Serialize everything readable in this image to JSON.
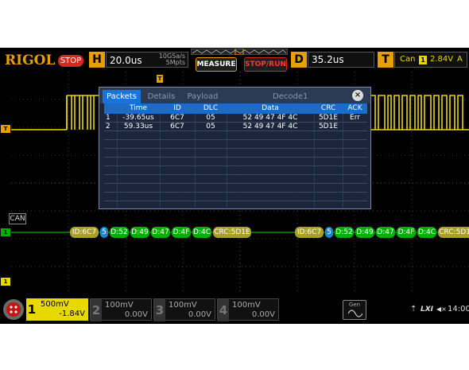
{
  "brand": {
    "logo": "RIGOL",
    "run_state": "STOP"
  },
  "horizontal": {
    "key": "H",
    "timebase": "20.0us",
    "sample_rate": "10GSa/s",
    "memory_depth": "5Mpts"
  },
  "buttons": {
    "measure": "MEASURE",
    "stop_run": "STOP/RUN"
  },
  "delay": {
    "key": "D",
    "value": "35.2us"
  },
  "trigger": {
    "key": "T",
    "source": "Can",
    "channel": "1",
    "level": "2.84V",
    "mode": "A"
  },
  "markers": {
    "trigger_level": "T",
    "channel1": "1",
    "decode_ref": "1",
    "channel2": "2",
    "trigger_pos": "T"
  },
  "decode_label": "CAN",
  "decode_frames": [
    [
      "ID:6C7",
      "5",
      "D:52",
      "D:49",
      "D:47",
      "D:4F",
      "D:4C",
      "CRC:5D1E"
    ],
    [
      "ID:6C7",
      "5",
      "D:52",
      "D:49",
      "D:47",
      "D:4F",
      "D:4C",
      "CRC:5D1E"
    ]
  ],
  "event_table": {
    "tabs": [
      "Packets",
      "Details",
      "Payload"
    ],
    "active_tab": 0,
    "title": "Decode1",
    "close": "×",
    "columns": [
      "",
      "Time",
      "ID",
      "DLC",
      "Data",
      "CRC",
      "ACK"
    ],
    "rows": [
      [
        "1",
        "-39.65us",
        "6C7",
        "05",
        "52 49 47 4F 4C",
        "5D1E",
        "Err"
      ],
      [
        "2",
        "59.33us",
        "6C7",
        "05",
        "52 49 47 4F 4C",
        "5D1E",
        ""
      ]
    ]
  },
  "channels": [
    {
      "num": "1",
      "scale": "500mV",
      "offset": "-1.84V",
      "active": true
    },
    {
      "num": "2",
      "scale": "100mV",
      "offset": "0.00V",
      "active": false
    },
    {
      "num": "3",
      "scale": "100mV",
      "offset": "0.00V",
      "active": false
    },
    {
      "num": "4",
      "scale": "100mV",
      "offset": "0.00V",
      "active": false
    }
  ],
  "generator": {
    "label": "Gen"
  },
  "status": {
    "usb": "⇡",
    "lxi": "LXI",
    "sound": "◀×",
    "time": "14:00"
  },
  "colors": {
    "ch1": "#e8d800",
    "accent": "#e8a000",
    "decode_green": "#00b000",
    "decode_olive": "#a8a028",
    "decode_blue": "#1a88c8",
    "tab_blue": "#1874d8",
    "stop_red": "#d42a1a"
  }
}
